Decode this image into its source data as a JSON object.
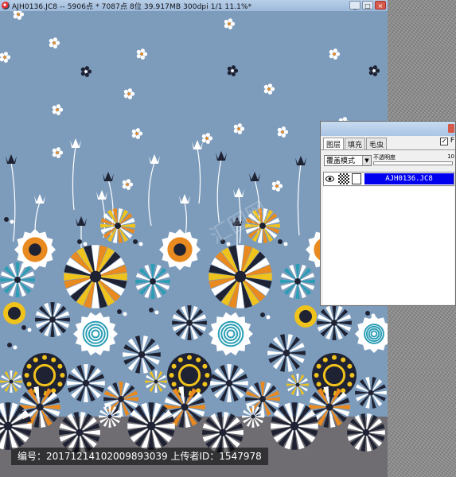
{
  "window": {
    "title": "AJH0136.JC8 -- 5906点 * 7087点 8位  39.917MB 300dpi 1/1   11.1%*",
    "buttons": {
      "minimize": "_",
      "maximize": "□",
      "close": "×"
    }
  },
  "panel": {
    "tabs": [
      "图层",
      "填充",
      "毛虫"
    ],
    "check_mark": "✓",
    "corner_letter": "F",
    "blend_mode": "覆盖模式",
    "opacity_label": "不透明度",
    "opacity_value": "10",
    "layer_name": "AJH0136.JC8"
  },
  "watermark": "汇图网",
  "caption": "编号：20171214102009893039 上传者ID：1547978",
  "colors": {
    "canvas_blue": "#7d9cbc",
    "band_gray": "#6f6d72",
    "navy": "#1e2233",
    "orange": "#e88a20",
    "yellow": "#f0c21c",
    "teal": "#2b9eb5",
    "selected_layer": "#0000ee"
  }
}
